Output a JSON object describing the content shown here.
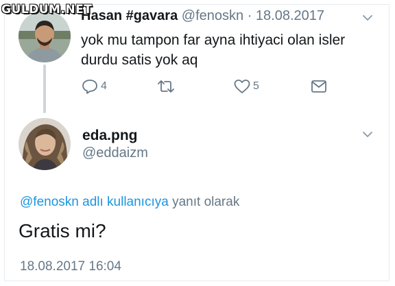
{
  "watermark": "GULDUM.NET",
  "tweet1": {
    "display_name": "Hasan #gavara",
    "handle": "@fenoskn",
    "separator": "·",
    "date": "18.08.2017",
    "text": "yok mu tampon far ayna ihtiyaci olan isler durdu satis yok aq",
    "reply_count": "4",
    "like_count": "5"
  },
  "tweet2": {
    "display_name": "eda.png",
    "handle": "@eddaizm",
    "reply_mention": "@fenoskn",
    "reply_link": "adlı kullanıcıya",
    "reply_suffix": "yanıt olarak",
    "text": "Gratis mi?",
    "timestamp": "18.08.2017 16:04"
  },
  "colors": {
    "text": "#14171a",
    "secondary": "#657786",
    "link": "#1b95e0",
    "thread_line": "#ccd6dd"
  },
  "icons": [
    "reply-icon",
    "retweet-icon",
    "like-icon",
    "message-icon",
    "chevron-down-icon"
  ]
}
